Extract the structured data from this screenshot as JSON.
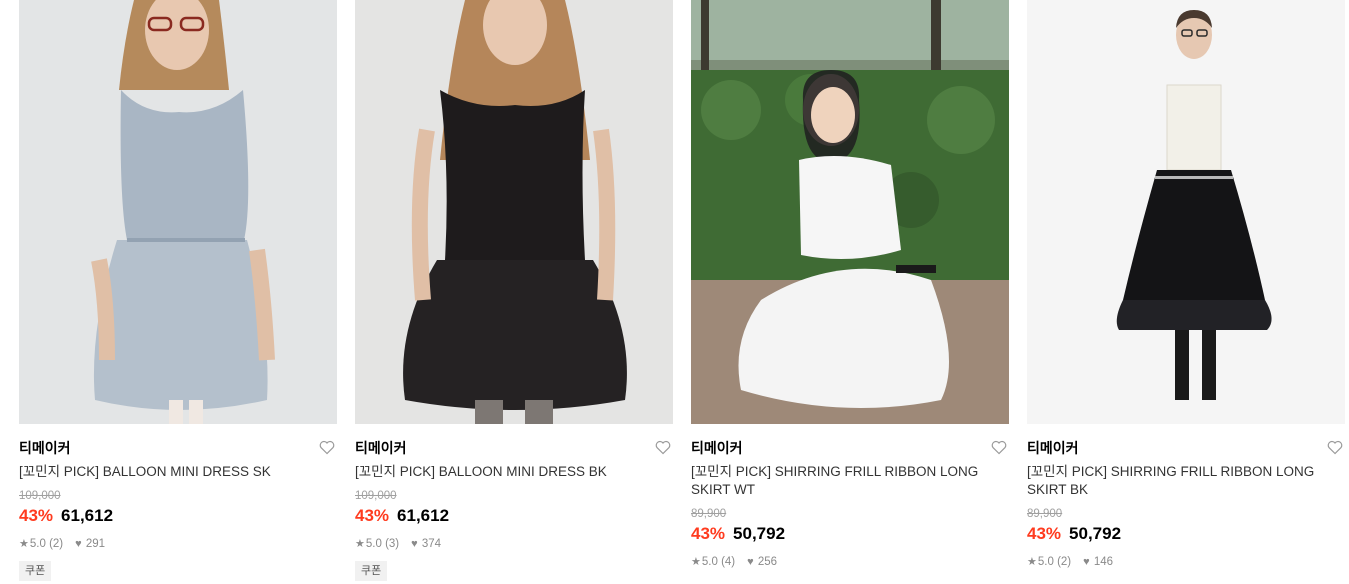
{
  "products": [
    {
      "brand": "티메이커",
      "name": "[꼬민지 PICK] BALLOON MINI DRESS SK",
      "original_price": "109,000",
      "discount": "43%",
      "price": "61,612",
      "rating": "5.0",
      "reviews": "(2)",
      "likes": "291",
      "coupon": "쿠폰",
      "image": "model in light blue sleeveless balloon mini dress",
      "colors": {
        "dress": "#a9b6c4",
        "bg": "#e3e5e6"
      }
    },
    {
      "brand": "티메이커",
      "name": "[꼬민지 PICK] BALLOON MINI DRESS BK",
      "original_price": "109,000",
      "discount": "43%",
      "price": "61,612",
      "rating": "5.0",
      "reviews": "(3)",
      "likes": "374",
      "coupon": "쿠폰",
      "image": "model in black sleeveless balloon mini dress",
      "colors": {
        "dress": "#1e1b1c",
        "bg": "#e4e4e3"
      }
    },
    {
      "brand": "티메이커",
      "name": "[꼬민지 PICK] SHIRRING FRILL RIBBON LONG SKIRT WT",
      "original_price": "89,900",
      "discount": "43%",
      "price": "50,792",
      "rating": "5.0",
      "reviews": "(4)",
      "likes": "256",
      "coupon": "",
      "image": "model crouching outdoors in white frill skirt",
      "colors": {
        "dress": "#f4f4f4",
        "bg": "#3f6b34"
      }
    },
    {
      "brand": "티메이커",
      "name": "[꼬민지 PICK] SHIRRING FRILL RIBBON LONG SKIRT BK",
      "original_price": "89,900",
      "discount": "43%",
      "price": "50,792",
      "rating": "5.0",
      "reviews": "(2)",
      "likes": "146",
      "coupon": "",
      "image": "model in white tube top and black frill long skirt",
      "colors": {
        "dress": "#141416",
        "bg": "#f5f5f5"
      }
    }
  ],
  "icons": {
    "wishlist": "heart-outline-icon",
    "rating": "star-icon",
    "likes": "heart-filled-icon"
  },
  "accent_color": "#ff3b1f"
}
